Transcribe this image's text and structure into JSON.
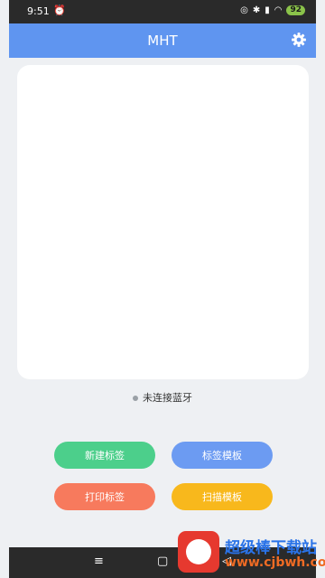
{
  "status_bar": {
    "time": "9:51",
    "battery": "92"
  },
  "app_bar": {
    "title": "MHT"
  },
  "connection": {
    "status_text": "未连接蓝牙"
  },
  "buttons": {
    "new_label": "新建标签",
    "label_template": "标签模板",
    "print_label": "打印标签",
    "scan_template": "扫描模板"
  },
  "nav": {
    "menu": "≡",
    "home": "▢",
    "back": "◁"
  },
  "watermark": {
    "title": "超级棒下载站",
    "url": "www.cjbwh.com"
  },
  "colors": {
    "app_bar": "#5f95f0",
    "btn_new": "#4ccf8b",
    "btn_template": "#6c9bf2",
    "btn_print": "#f77a5d",
    "btn_scan": "#f8b81c"
  }
}
